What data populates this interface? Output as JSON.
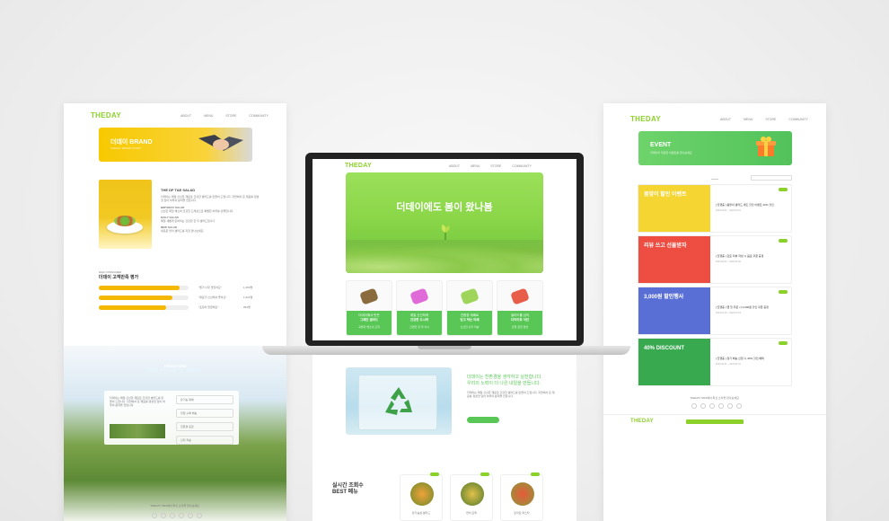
{
  "brand": {
    "logo": "THEDAY"
  },
  "nav": [
    "ABOUT",
    "MENU",
    "STORE",
    "COMMUNITY"
  ],
  "left_page": {
    "banner_title": "더데이 BRAND",
    "banner_sub": "THEDAY BRAND STORY",
    "section_title": "THE DF TAE SALAD",
    "para1": "더데이는 매일 신선한 재료로 건강한 샐러드를 만들어 드립니다. 자연에서 온 재료를 정성껏 담아 하루의 활력을 전합니다.",
    "sub1": "BIRTHDAY SALAD",
    "para2": "신선한 제철 채소와 건강한 드레싱으로 특별한 하루를 선물합니다.",
    "sub2": "DAILY SALAD",
    "para3": "매일 새롭게 준비되는 건강한 한 끼 샐러드입니다.",
    "sub3": "NEW SALAD",
    "para4": "새로운 맛의 샐러드를 지금 만나보세요.",
    "stats_year": "2022 CONSUMER",
    "stats_title": "더데이 고객만족 평가",
    "bars": [
      {
        "pct": 0.9,
        "label": "\"뭔가 너무 맛있어요\"",
        "count": "1,254명"
      },
      {
        "pct": 0.82,
        "label": "\"재료가 신선해서 좋아요\"",
        "count": "1,021명"
      },
      {
        "pct": 0.75,
        "label": "\"포장이 깔끔해요\"",
        "count": "954명"
      }
    ],
    "farm_title": "THEDAY FARM",
    "farm_sub": "더데이 신선 재료를 직접 재배합니다",
    "farm_items": [
      "유기농 재배",
      "당일 수확 배송",
      "친환경 포장",
      "산지 직송"
    ],
    "footer_text": "THEDAY SNS에서 최신 소식을 만나보세요."
  },
  "right_page": {
    "banner_title": "EVENT",
    "banner_sub": "더데이의 다양한 이벤트를 만나보세요",
    "events": [
      {
        "thumb": "봄맞이 할인 이벤트",
        "desc": "[ 진행중 ] 봄맞이 샐러드 세트 할인 이벤트 20% 할인",
        "date": "2023.03.01 ~ 2023.03.31",
        "color": "#f5d531"
      },
      {
        "thumb": "리뷰 쓰고 선물받자",
        "desc": "[ 진행중 ] 포토 리뷰 작성 시 음료 쿠폰 증정",
        "date": "2023.03.01 ~ 2023.04.30",
        "color": "#ee4e42"
      },
      {
        "thumb": "3,000원 할인행사",
        "desc": "[ 진행중 ] 앱 첫 주문 시 3,000원 할인 쿠폰 증정",
        "date": "2023.02.15 ~ 2023.03.15",
        "color": "#5a6fd6"
      },
      {
        "thumb": "40% DISCOUNT",
        "desc": "[ 진행중 ] 정기 배송 신청 시 40% 할인 혜택",
        "date": "2023.02.01 ~ 2023.03.31",
        "color": "#38a94f"
      }
    ],
    "footer_text": "THEDAY SNS에서 최신 소식을 만나보세요."
  },
  "laptop": {
    "hero_headline": "더데이에도 봄이 왔나봄",
    "products": [
      {
        "name": "더데이에서 만든",
        "name2": "그레인 샐러드",
        "sub": "곡물과 채소의 조화"
      },
      {
        "name": "매일 신선하게",
        "name2": "건강한 도시락",
        "sub": "간편한 한 끼 식사"
      },
      {
        "name": "친환경 재배로",
        "name2": "믿고 먹는 야채",
        "sub": "신선한 산지 직송"
      },
      {
        "name": "샐러드를 넘어",
        "name2": "다이어트 식단",
        "sub": "균형 잡힌 영양"
      }
    ]
  },
  "below": {
    "eco_text_1": "더데이는 친환경을 생각하고 실천합니다.",
    "eco_text_2": "우리의 노력이 더 나은 내일을 만듭니다.",
    "best_title_1": "실시간 조회수",
    "best_title_2": "BEST 메뉴",
    "foods": [
      "닭가슴살 샐러드",
      "연어 포케",
      "토마토 파스타"
    ]
  },
  "colors": {
    "accent": "#8bd12a",
    "green": "#58c755",
    "yellow": "#f5b800"
  }
}
